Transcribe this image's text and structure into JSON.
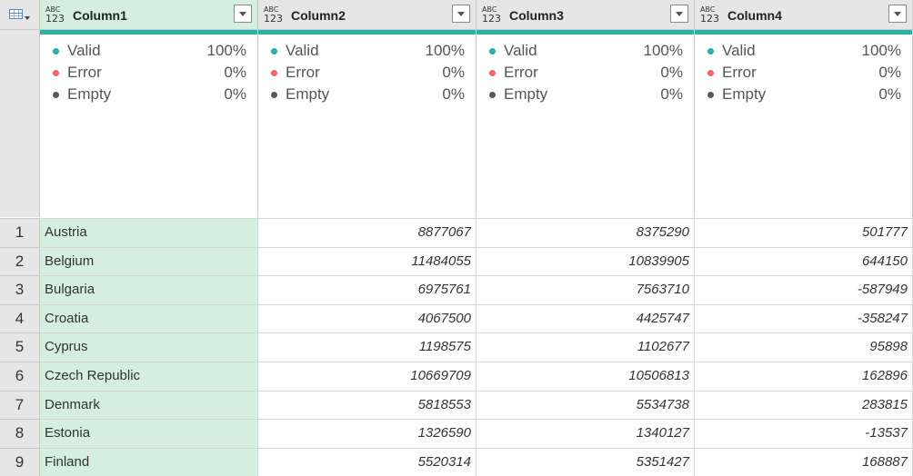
{
  "columns": [
    {
      "type_top": "ABC",
      "type_bottom": "123",
      "name": "Column1",
      "quality": {
        "valid": "100%",
        "error": "0%",
        "empty": "0%"
      }
    },
    {
      "type_top": "ABC",
      "type_bottom": "123",
      "name": "Column2",
      "quality": {
        "valid": "100%",
        "error": "0%",
        "empty": "0%"
      }
    },
    {
      "type_top": "ABC",
      "type_bottom": "123",
      "name": "Column3",
      "quality": {
        "valid": "100%",
        "error": "0%",
        "empty": "0%"
      }
    },
    {
      "type_top": "ABC",
      "type_bottom": "123",
      "name": "Column4",
      "quality": {
        "valid": "100%",
        "error": "0%",
        "empty": "0%"
      }
    }
  ],
  "quality_labels": {
    "valid": "Valid",
    "error": "Error",
    "empty": "Empty"
  },
  "quality_colors": {
    "valid": "#26b3a6",
    "error": "#f0665f",
    "empty": "#595959"
  },
  "rows": [
    {
      "num": "1",
      "cells": [
        "Austria",
        "8877067",
        "8375290",
        "501777"
      ]
    },
    {
      "num": "2",
      "cells": [
        "Belgium",
        "11484055",
        "10839905",
        "644150"
      ]
    },
    {
      "num": "3",
      "cells": [
        "Bulgaria",
        "6975761",
        "7563710",
        "-587949"
      ]
    },
    {
      "num": "4",
      "cells": [
        "Croatia",
        "4067500",
        "4425747",
        "-358247"
      ]
    },
    {
      "num": "5",
      "cells": [
        "Cyprus",
        "1198575",
        "1102677",
        "95898"
      ]
    },
    {
      "num": "6",
      "cells": [
        "Czech Republic",
        "10669709",
        "10506813",
        "162896"
      ]
    },
    {
      "num": "7",
      "cells": [
        "Denmark",
        "5818553",
        "5534738",
        "283815"
      ]
    },
    {
      "num": "8",
      "cells": [
        "Estonia",
        "1326590",
        "1340127",
        "-13537"
      ]
    },
    {
      "num": "9",
      "cells": [
        "Finland",
        "5520314",
        "5351427",
        "168887"
      ]
    }
  ]
}
